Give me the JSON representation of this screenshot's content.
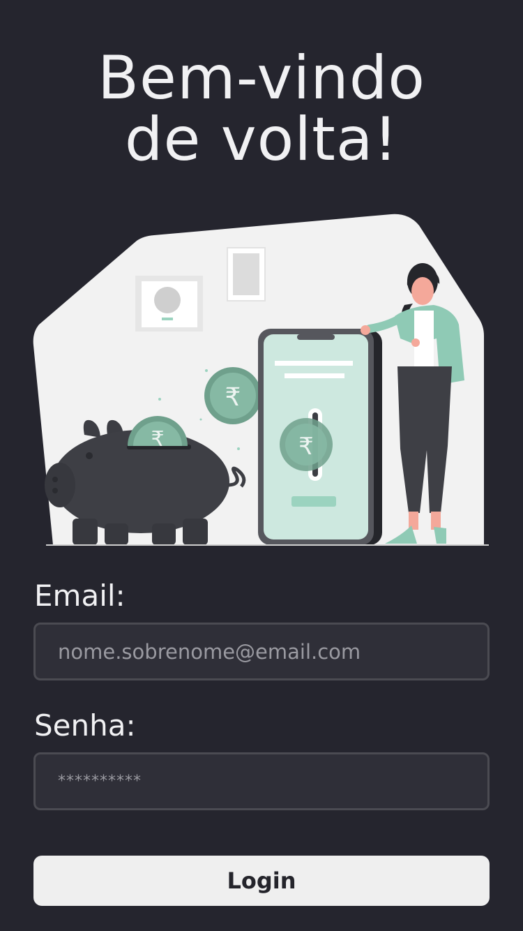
{
  "header": {
    "title_line1": "Bem-vindo",
    "title_line2": "de volta!"
  },
  "illustration": {
    "description_icon": "savings-piggy-bank-phone-illustration",
    "coin_symbol": "₹"
  },
  "form": {
    "email_label": "Email:",
    "email_placeholder": "nome.sobrenome@email.com",
    "password_label": "Senha:",
    "password_placeholder": "**********",
    "login_label": "Login"
  },
  "colors": {
    "background": "#25252e",
    "accent": "#9bd3bf",
    "button_bg": "#efefef",
    "input_bg": "#2f2f38"
  }
}
